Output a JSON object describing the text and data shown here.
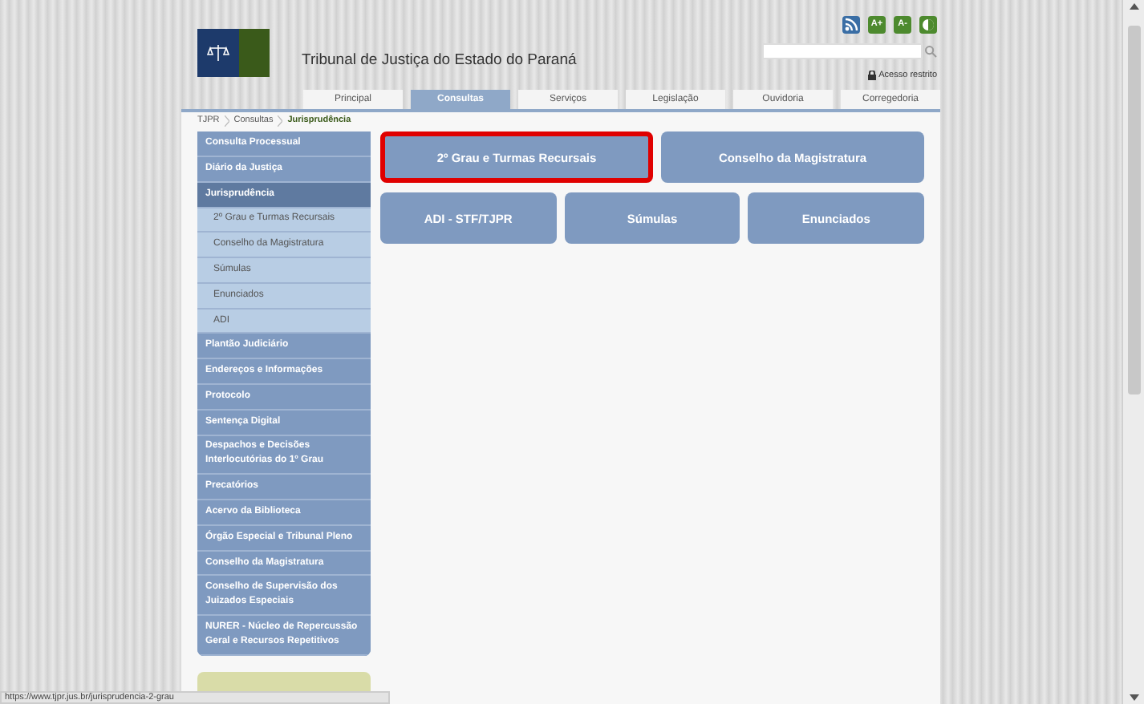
{
  "header": {
    "title": "Tribunal de Justiça do Estado do Paraná",
    "restricted_link": "Acesso restrito",
    "font_buttons": [
      "A+",
      "A-"
    ]
  },
  "nav_tabs": [
    {
      "label": "Principal",
      "selected": false
    },
    {
      "label": "Consultas",
      "selected": true
    },
    {
      "label": "Serviços",
      "selected": false
    },
    {
      "label": "Legislação",
      "selected": false
    },
    {
      "label": "Ouvidoria",
      "selected": false
    },
    {
      "label": "Corregedoria",
      "selected": false
    }
  ],
  "breadcrumb": [
    "TJPR",
    "Consultas",
    "Jurisprudência"
  ],
  "sidebar": {
    "items": [
      {
        "kind": "section",
        "label": "Consulta Processual",
        "selected": false
      },
      {
        "kind": "section",
        "label": "Diário da Justiça",
        "selected": false
      },
      {
        "kind": "section",
        "label": "Jurisprudência",
        "selected": true
      },
      {
        "kind": "sub",
        "label": "2º Grau e Turmas Recursais",
        "selected": false
      },
      {
        "kind": "sub",
        "label": "Conselho da Magistratura",
        "selected": false
      },
      {
        "kind": "sub",
        "label": "Súmulas",
        "selected": false
      },
      {
        "kind": "sub",
        "label": "Enunciados",
        "selected": false
      },
      {
        "kind": "sub",
        "label": "ADI",
        "selected": false
      },
      {
        "kind": "section",
        "label": "Plantão Judiciário",
        "selected": false
      },
      {
        "kind": "section",
        "label": "Endereços e Informações",
        "selected": false
      },
      {
        "kind": "section",
        "label": "Protocolo",
        "selected": false
      },
      {
        "kind": "section",
        "label": "Sentença Digital",
        "selected": false
      },
      {
        "kind": "section",
        "label": "Despachos e Decisões Interlocutórias do 1º Grau",
        "selected": false
      },
      {
        "kind": "section",
        "label": "Precatórios",
        "selected": false
      },
      {
        "kind": "section",
        "label": "Acervo da Biblioteca",
        "selected": false
      },
      {
        "kind": "section",
        "label": "Órgão Especial e Tribunal Pleno",
        "selected": false
      },
      {
        "kind": "section",
        "label": "Conselho da Magistratura",
        "selected": false
      },
      {
        "kind": "section",
        "label": "Conselho de Supervisão dos Juizados Especiais",
        "selected": false
      },
      {
        "kind": "section",
        "label": "NURER - Núcleo de Repercussão Geral e Recursos Repetitivos",
        "selected": false
      }
    ]
  },
  "tiles": [
    [
      {
        "label": "2º Grau e Turmas Recursais",
        "highlighted": true
      },
      {
        "label": "Conselho da Magistratura",
        "highlighted": false
      }
    ],
    [
      {
        "label": "ADI - STF/TJPR",
        "highlighted": false
      },
      {
        "label": "Súmulas",
        "highlighted": false
      },
      {
        "label": "Enunciados",
        "highlighted": false
      }
    ]
  ],
  "status_bar": "https://www.tjpr.jus.br/jurisprudencia-2-grau"
}
